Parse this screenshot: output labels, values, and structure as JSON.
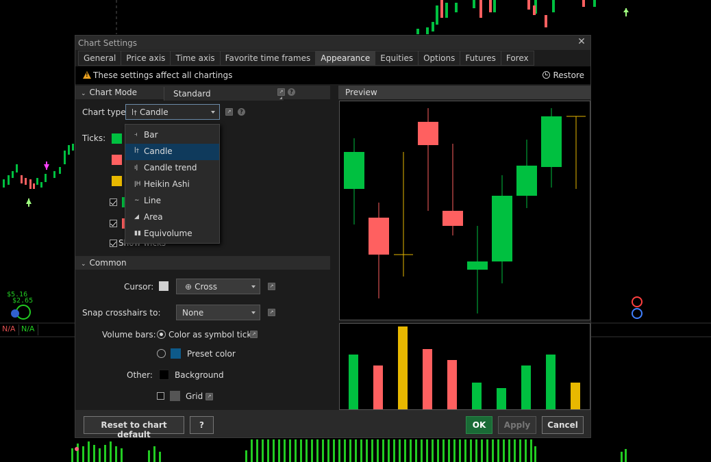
{
  "dialog": {
    "title": "Chart Settings",
    "tabs": [
      {
        "label": "General"
      },
      {
        "label": "Price axis"
      },
      {
        "label": "Time axis"
      },
      {
        "label": "Favorite time frames"
      },
      {
        "label": "Appearance",
        "active": true
      },
      {
        "label": "Equities"
      },
      {
        "label": "Options"
      },
      {
        "label": "Futures"
      },
      {
        "label": "Forex"
      }
    ],
    "info": "These settings affect all chartings",
    "restore": "Restore"
  },
  "chart_mode": {
    "header": "Chart Mode",
    "value": "Standard",
    "chart_type_label": "Chart type:",
    "chart_type_value": "Candle",
    "ticks_label": "Ticks:",
    "show_wicks_label": "Show wicks",
    "tick_colors": [
      "#00c040",
      "#ff6060",
      "#e8b800"
    ]
  },
  "dropdown": {
    "options": [
      {
        "label": "Bar",
        "icon": "bar-icon"
      },
      {
        "label": "Candle",
        "icon": "candle-icon",
        "selected": true
      },
      {
        "label": "Candle trend",
        "icon": "candle-trend-icon"
      },
      {
        "label": "Heikin Ashi",
        "icon": "heikin-ashi-icon"
      },
      {
        "label": "Line",
        "icon": "line-icon"
      },
      {
        "label": "Area",
        "icon": "area-icon"
      },
      {
        "label": "Equivolume",
        "icon": "equivolume-icon"
      }
    ]
  },
  "common": {
    "header": "Common",
    "cursor_label": "Cursor:",
    "cursor_value": "Cross",
    "snap_label": "Snap crosshairs to:",
    "snap_value": "None",
    "volume_label": "Volume bars:",
    "volume_opt1": "Color as symbol ticks",
    "volume_opt2": "Preset color",
    "other_label": "Other:",
    "background_label": "Background",
    "grid_label": "Grid"
  },
  "preview": {
    "header": "Preview"
  },
  "footer": {
    "reset": "Reset to chart default",
    "help": "?",
    "ok": "OK",
    "apply": "Apply",
    "cancel": "Cancel"
  },
  "background": {
    "price1": "$5.16",
    "price2": "$2.65",
    "na1": "N/A",
    "na2": "N/A"
  },
  "colors": {
    "up": "#00c040",
    "down": "#ff6060",
    "neutral": "#e8b800",
    "accent": "#1a6b36"
  }
}
